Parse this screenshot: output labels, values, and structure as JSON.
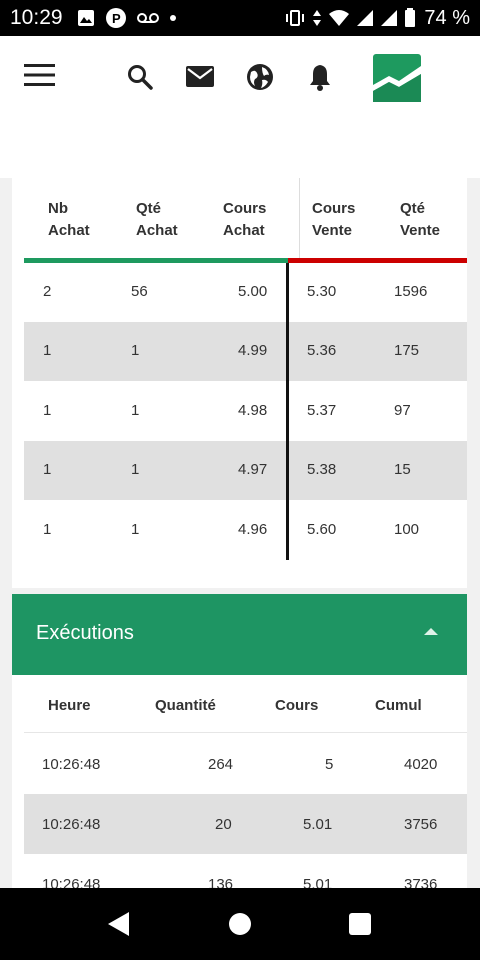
{
  "status_bar": {
    "time": "10:29",
    "battery_percent": "74 %",
    "left_icons": [
      "image-icon",
      "app-p-icon",
      "voicemail-icon",
      "dot-icon"
    ],
    "right_icons": [
      "vibrate-icon",
      "data-arrows-icon",
      "wifi-icon",
      "signal-icon",
      "signal-icon",
      "battery-icon"
    ]
  },
  "header": {
    "icons": [
      "menu-icon",
      "search-icon",
      "mail-icon",
      "globe-icon",
      "bell-icon",
      "logo-icon"
    ],
    "logo_color": "#1e9a5f"
  },
  "order_book": {
    "headers": {
      "nb_achat": [
        "Nb",
        "Achat"
      ],
      "qte_achat": [
        "Qté",
        "Achat"
      ],
      "cours_achat": [
        "Cours",
        "Achat"
      ],
      "cours_vente": [
        "Cours",
        "Vente"
      ],
      "qte_vente": [
        "Qté",
        "Vente"
      ]
    },
    "rows": [
      {
        "nb_achat": "2",
        "qte_achat": "56",
        "cours_achat": "5.00",
        "cours_vente": "5.30",
        "qte_vente": "1596"
      },
      {
        "nb_achat": "1",
        "qte_achat": "1",
        "cours_achat": "4.99",
        "cours_vente": "5.36",
        "qte_vente": "175"
      },
      {
        "nb_achat": "1",
        "qte_achat": "1",
        "cours_achat": "4.98",
        "cours_vente": "5.37",
        "qte_vente": "97"
      },
      {
        "nb_achat": "1",
        "qte_achat": "1",
        "cours_achat": "4.97",
        "cours_vente": "5.38",
        "qte_vente": "15"
      },
      {
        "nb_achat": "1",
        "qte_achat": "1",
        "cours_achat": "4.96",
        "cours_vente": "5.60",
        "qte_vente": "100"
      }
    ],
    "buy_color": "#1e9a5f",
    "sell_color": "#cc0000"
  },
  "executions": {
    "title": "Exécutions",
    "headers": {
      "heure": "Heure",
      "quantite": "Quantité",
      "cours": "Cours",
      "cumul": "Cumul"
    },
    "rows": [
      {
        "heure": "10:26:48",
        "quantite": "264",
        "cours": "5",
        "cumul": "4020"
      },
      {
        "heure": "10:26:48",
        "quantite": "20",
        "cours": "5.01",
        "cumul": "3756"
      },
      {
        "heure": "10:26:48",
        "quantite": "136",
        "cours": "5.01",
        "cumul": "3736"
      }
    ],
    "header_color": "#1e9563"
  },
  "nav_bar": {
    "icons": [
      "back-icon",
      "home-icon",
      "recents-icon"
    ]
  }
}
